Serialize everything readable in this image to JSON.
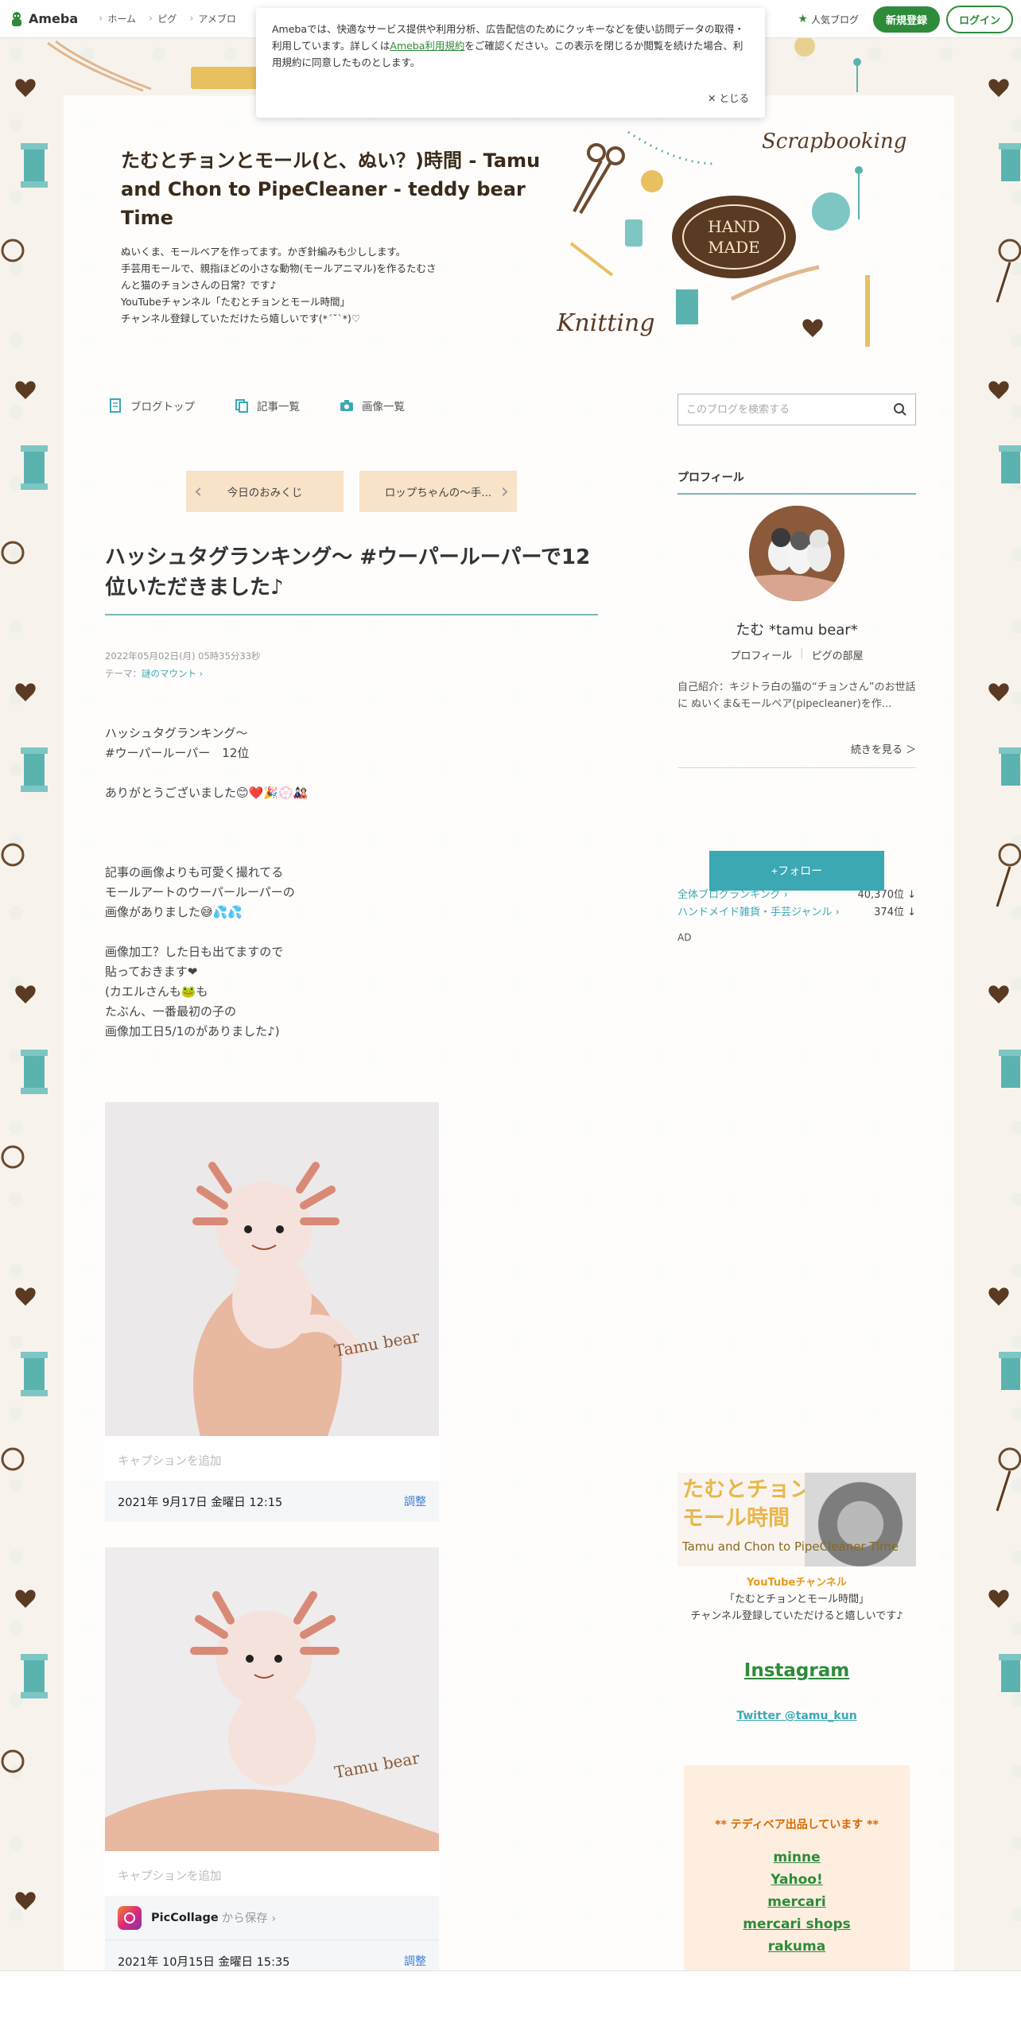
{
  "topbar": {
    "logo": "Ameba",
    "nav": [
      "ホーム",
      "ピグ",
      "アメブロ"
    ],
    "popular": "人気ブログ",
    "register": "新規登録",
    "login": "ログイン"
  },
  "cookie": {
    "text_before": "Amebaでは、快適なサービス提供や利用分析、広告配信のためにクッキーなどを使い訪問データの取得・利用しています。詳しくは",
    "link": "Ameba利用規約",
    "text_after": "をご確認ください。この表示を閉じるか閲覧を続けた場合、利用規約に同意したものとします。",
    "close": "とじる"
  },
  "blog": {
    "title": "たむとチョンとモール(と、ぬい？)時間 - Tamu and Chon to PipeCleaner - teddy bear Time",
    "desc": [
      "ぬいくま、モールベアを作ってます。かぎ針編みも少しします。",
      "手芸用モールで、親指ほどの小さな動物(モールアニマル)を作るたむさ",
      "んと猫のチョンさんの日常？です♪",
      "YouTubeチャンネル「たむとチョンとモール時間」",
      "チャンネル登録していただけたら嬉しいです(*´˘`*)♡"
    ],
    "nav": [
      "ブログトップ",
      "記事一覧",
      "画像一覧"
    ],
    "search_placeholder": "このブログを検索する"
  },
  "article": {
    "prev": "今日のおみくじ",
    "next": "ロップちゃんの〜手...",
    "title": "ハッシュタグランキング〜 #ウーパールーパーで12位いただきました♪",
    "date": "2022年05月02日(月) 05時35分33秒",
    "theme_label": "テーマ：",
    "theme": "謎のマウント",
    "body": [
      [
        "ハッシュタグランキング〜",
        "#ウーパールーパー　12位"
      ],
      [
        "ありがとうございました😊❤️🎉💮🎎"
      ],
      [
        ""
      ],
      [
        "記事の画像よりも可愛く撮れてる",
        "モールアートのウーパールーパーの",
        "画像がありました😅💦💦"
      ],
      [
        "画像加工？した日も出てますので",
        "貼っておきます❤",
        "(カエルさんも🐸も",
        "たぶん、一番最初の子の",
        "画像加工日5/1のがありました♪)"
      ]
    ],
    "photos": [
      {
        "watermark": "Tamu bear",
        "caption_placeholder": "キャプションを追加",
        "date": "2021年 9月17日 金曜日 12:15",
        "adjust": "調整"
      },
      {
        "watermark": "Tamu bear",
        "caption_placeholder": "キャプションを追加",
        "app": "PicCollage",
        "app_save": "から保存 ›",
        "date": "2021年 10月15日 金曜日 15:35",
        "adjust": "調整"
      }
    ]
  },
  "sidebar": {
    "profile_title": "プロフィール",
    "name": "たむ *tamu bear*",
    "links": [
      "プロフィール",
      "ピグの部屋"
    ],
    "intro": "自己紹介：キジトラ白の猫の“チョンさん”のお世話に ぬいくま&モールベア(pipecleaner)を作...",
    "read_more": "続きを見る ＞",
    "ranks": [
      {
        "label": "全体ブログランキング ›",
        "value": "40,370位 ↓"
      },
      {
        "label": "ハンドメイド雑貨・手芸ジャンル ›",
        "value": "374位 ↓"
      }
    ],
    "follow": "+フォロー",
    "ad": "AD",
    "banner": {
      "title_line1": "たむとチョン🐱と",
      "title_line2": "モール時間",
      "sub": "Tamu and Chon to PipeCleaner Time"
    },
    "youtube": {
      "title": "YouTubeチャンネル",
      "line1": "「たむとチョンとモール時間」",
      "line2": "チャンネル登録していただけると嬉しいです♪"
    },
    "instagram": "Instagram",
    "twitter": "Twitter @tamu_kun",
    "shop_title": "** テディベア出品しています **",
    "shops": [
      "minne",
      "Yahoo!",
      "mercari",
      "mercari shops",
      "rakuma"
    ]
  },
  "colors": {
    "ameba_green": "#2e8b3a",
    "teal": "#3ba8b4",
    "pager_bg": "#f8e2c8"
  }
}
